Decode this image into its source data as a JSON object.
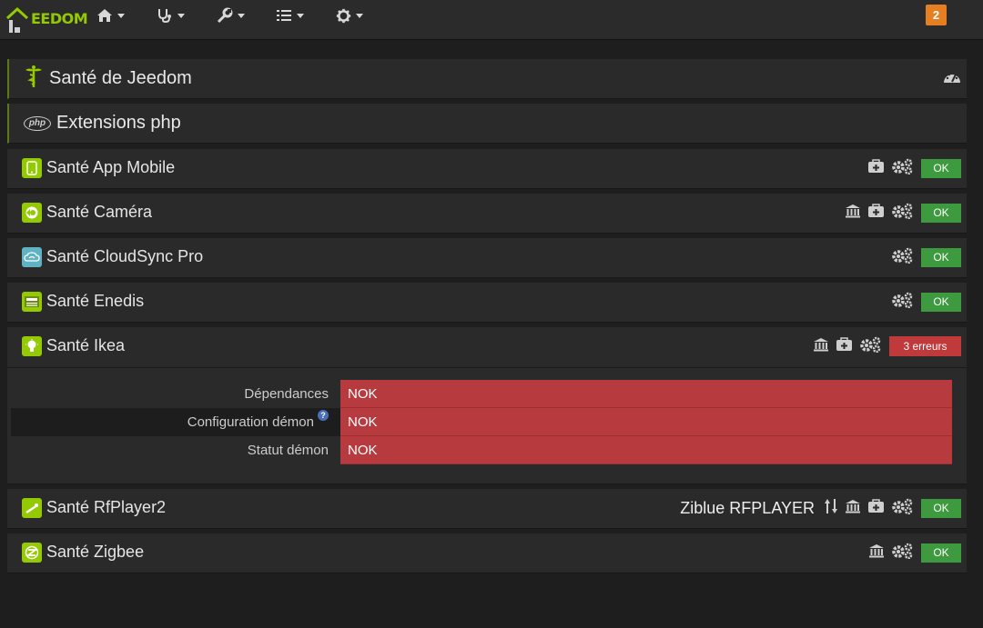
{
  "navbar": {
    "logo_text": "EEDOM",
    "notification_count": "2",
    "menus": [
      {
        "icon": "home-icon"
      },
      {
        "icon": "stethoscope-icon"
      },
      {
        "icon": "wrench-icon"
      },
      {
        "icon": "tasks-icon"
      },
      {
        "icon": "gear-icon"
      }
    ]
  },
  "health": {
    "title": "Santé de Jeedom",
    "php_badge": "php",
    "php_title": "Extensions php"
  },
  "plugins": [
    {
      "name": "Santé App Mobile",
      "status": "OK"
    },
    {
      "name": "Santé Caméra",
      "status": "OK"
    },
    {
      "name": "Santé CloudSync Pro",
      "status": "OK"
    },
    {
      "name": "Santé Enedis",
      "status": "OK"
    },
    {
      "name": "Santé Ikea",
      "status": "3 erreurs"
    },
    {
      "name": "Santé RfPlayer2",
      "status": "OK",
      "equipment": "Ziblue RFPLAYER"
    },
    {
      "name": "Santé Zigbee",
      "status": "OK"
    }
  ],
  "ikea_details": [
    {
      "label": "Dépendances",
      "value": "NOK"
    },
    {
      "label": "Configuration démon",
      "value": "NOK",
      "help": "?"
    },
    {
      "label": "Statut démon",
      "value": "NOK"
    }
  ],
  "colors": {
    "accent": "#94ca02",
    "ok": "#3e9a3e",
    "error": "#c0393b",
    "notification": "#e67e22"
  }
}
